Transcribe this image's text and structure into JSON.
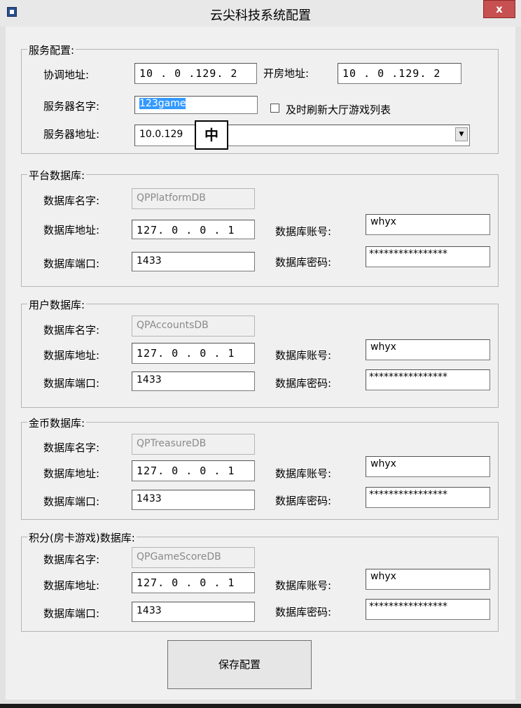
{
  "window": {
    "title": "云尖科技系统配置",
    "close_label": "x"
  },
  "service": {
    "group_label": "服务配置:",
    "coord_label": "协调地址:",
    "coord_value": "10 . 0 .129. 2",
    "room_label": "开房地址:",
    "room_value": "10 . 0 .129. 2",
    "name_label": "服务器名字:",
    "name_value": "123game",
    "refresh_label": "及时刷新大厅游戏列表",
    "addr_label": "服务器地址:",
    "addr_value": "10.0.129",
    "ime_indicator": "中"
  },
  "db_labels": {
    "name": "数据库名字:",
    "addr": "数据库地址:",
    "port": "数据库端口:",
    "account": "数据库账号:",
    "password": "数据库密码:"
  },
  "platform_db": {
    "group_label": "平台数据库:",
    "name": "QPPlatformDB",
    "addr": "127. 0 . 0 . 1",
    "port": "1433",
    "account": "whyx",
    "password": "****************"
  },
  "accounts_db": {
    "group_label": "用户数据库:",
    "name": "QPAccountsDB",
    "addr": "127. 0 . 0 . 1",
    "port": "1433",
    "account": "whyx",
    "password": "****************"
  },
  "treasure_db": {
    "group_label": "金币数据库:",
    "name": "QPTreasureDB",
    "addr": "127. 0 . 0 . 1",
    "port": "1433",
    "account": "whyx",
    "password": "****************"
  },
  "score_db": {
    "group_label": "积分(房卡游戏)数据库:",
    "name": "QPGameScoreDB",
    "addr": "127. 0 . 0 . 1",
    "port": "1433",
    "account": "whyx",
    "password": "****************"
  },
  "save_label": "保存配置"
}
